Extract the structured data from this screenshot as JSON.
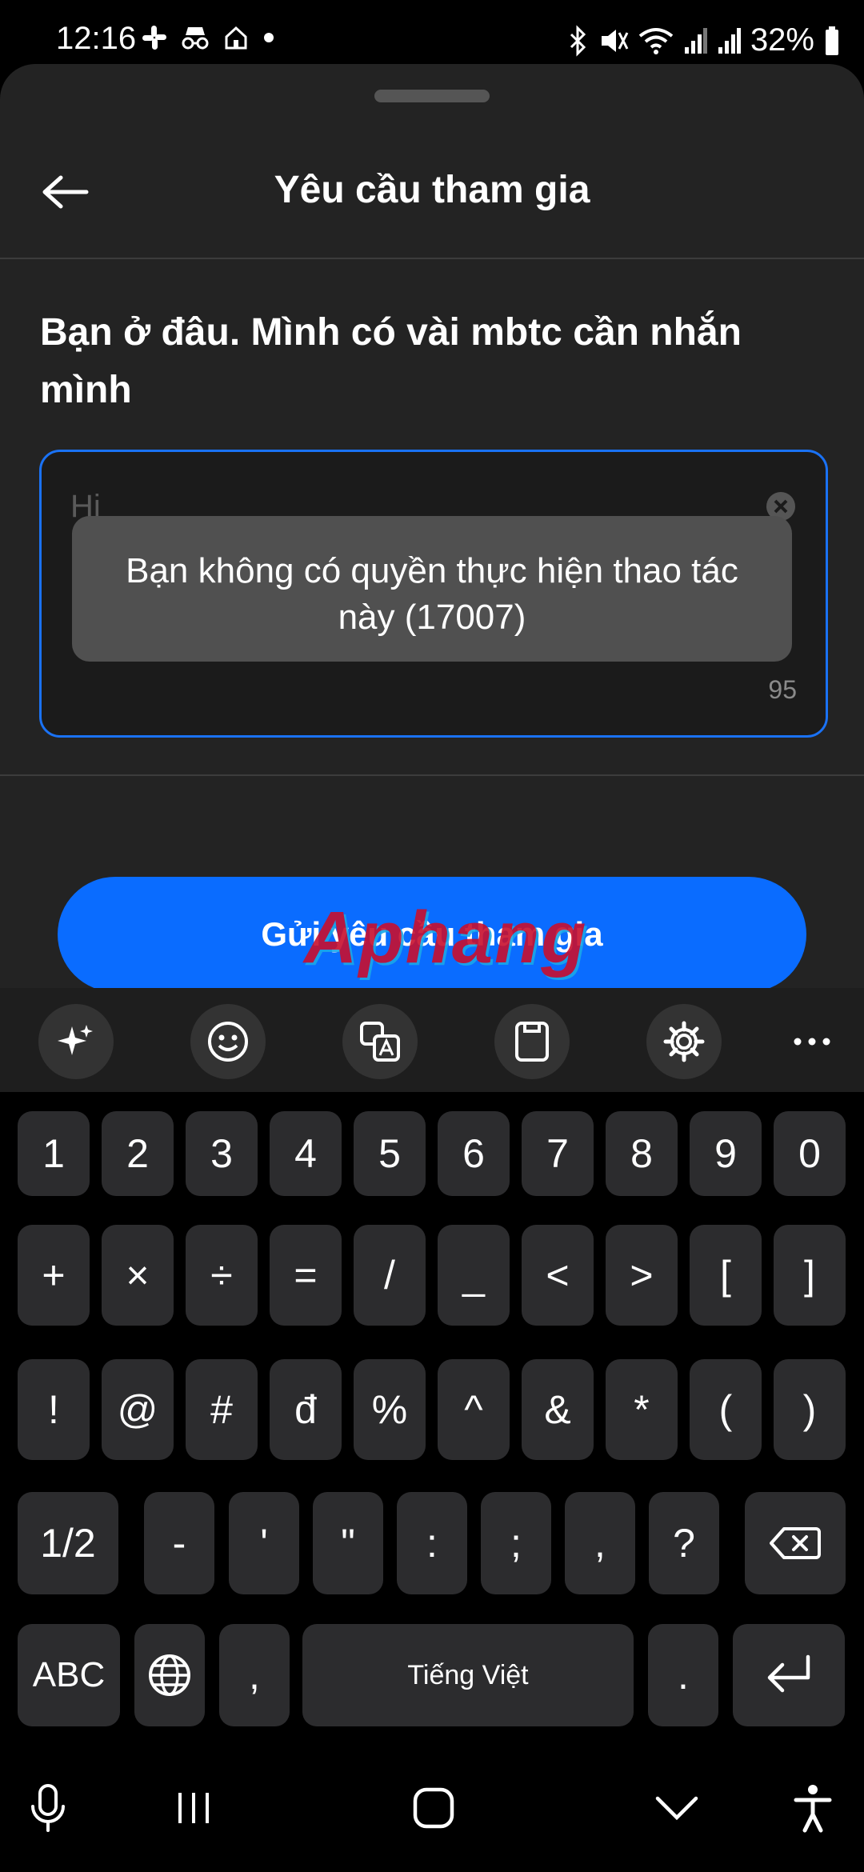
{
  "status_bar": {
    "time": "12:16",
    "battery": "32%",
    "left_icons": [
      "slack-icon",
      "incognito-icon",
      "home-icon",
      "dot-icon"
    ],
    "right_icons": [
      "bluetooth-icon",
      "mute-icon",
      "wifi-icon",
      "signal-icon",
      "signal-icon",
      "battery-icon"
    ]
  },
  "header": {
    "title": "Yêu cầu tham gia"
  },
  "form": {
    "question": "Bạn ở đâu. Mình có vài mbtc cần nhắn mình",
    "input_placeholder": "Hi",
    "char_counter": "95"
  },
  "toast": {
    "message": "Bạn không có quyền thực hiện thao tác này (17007)"
  },
  "submit_button": {
    "label": "Gửi yêu cầu tham gia"
  },
  "watermark": {
    "text": "Aphang"
  },
  "keyboard": {
    "toolbar": [
      "sparkle-icon",
      "emoji-icon",
      "translate-icon",
      "clipboard-icon",
      "settings-icon",
      "more-icon"
    ],
    "row1": [
      "1",
      "2",
      "3",
      "4",
      "5",
      "6",
      "7",
      "8",
      "9",
      "0"
    ],
    "row2": [
      "+",
      "×",
      "÷",
      "=",
      "/",
      "_",
      "<",
      ">",
      "[",
      "]"
    ],
    "row3": [
      "!",
      "@",
      "#",
      "đ",
      "%",
      "^",
      "&",
      "*",
      "(",
      ")"
    ],
    "row4": [
      "1/2",
      "-",
      "'",
      "\"",
      ":",
      ";",
      ",",
      "?"
    ],
    "row5": {
      "abc": "ABC",
      "comma": ",",
      "space": "Tiếng Việt",
      "period": "."
    }
  },
  "colors": {
    "accent": "#0a6cff",
    "sheet_bg": "#232323",
    "key_bg": "#2c2c2e"
  }
}
